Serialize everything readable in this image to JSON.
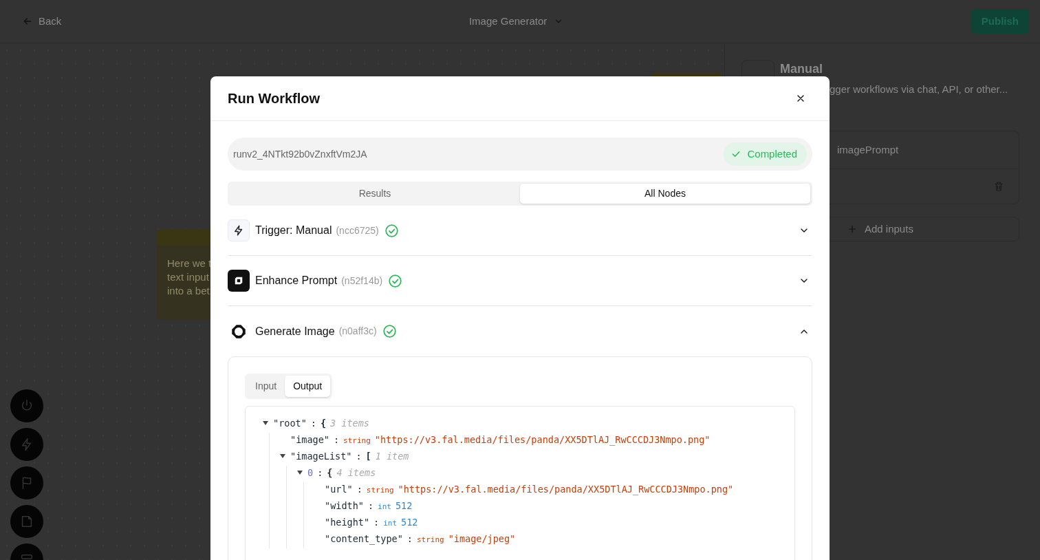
{
  "topbar": {
    "back": "Back",
    "workflow_name": "Image Generator",
    "publish": "Publish"
  },
  "canvas": {
    "note_lines": [
      "Here we t",
      "text input",
      "into a bet"
    ]
  },
  "side_panel": {
    "title": "Manual",
    "description": "gger workflows via chat, API, or other...",
    "input_name": "imagePrompt",
    "add_inputs": "Add inputs"
  },
  "modal": {
    "title": "Run Workflow",
    "run_id": "runv2_4NTkt92b0vZnxftVm2JA",
    "status": "Completed",
    "tabs": [
      {
        "label": "Results",
        "selected": false
      },
      {
        "label": "All Nodes",
        "selected": true
      }
    ],
    "nodes": [
      {
        "name": "Trigger: Manual",
        "node_id": "(ncc6725)",
        "done": true,
        "expanded": false
      },
      {
        "name": "Enhance Prompt",
        "node_id": "(n52f14b)",
        "done": true,
        "expanded": false
      },
      {
        "name": "Generate Image",
        "node_id": "(n0aff3c)",
        "done": true,
        "expanded": true
      }
    ],
    "detail_tabs": [
      {
        "label": "Input",
        "selected": false
      },
      {
        "label": "Output",
        "selected": true
      }
    ],
    "json_view": {
      "separator": ":",
      "tree": {
        "key": "\"root\"",
        "bracket": "{",
        "summary": "3 items",
        "expanded": true,
        "children": [
          {
            "key": "\"image\"",
            "type": "string",
            "kind": "string",
            "value": "\"https://v3.fal.media/files/panda/XX5DTlAJ_RwCCCDJ3Nmpo.png\""
          },
          {
            "key": "\"imageList\"",
            "bracket": "[",
            "summary": "1 item",
            "expanded": true,
            "children": [
              {
                "key": "0",
                "bracket": "{",
                "summary": "4 items",
                "expanded": true,
                "children": [
                  {
                    "key": "\"url\"",
                    "type": "string",
                    "kind": "string",
                    "value": "\"https://v3.fal.media/files/panda/XX5DTlAJ_RwCCCDJ3Nmpo.png\""
                  },
                  {
                    "key": "\"width\"",
                    "type": "int",
                    "kind": "int",
                    "value": "512"
                  },
                  {
                    "key": "\"height\"",
                    "type": "int",
                    "kind": "int",
                    "value": "512"
                  },
                  {
                    "key": "\"content_type\"",
                    "type": "string",
                    "kind": "string",
                    "value": "\"image/jpeg\""
                  }
                ]
              }
            ]
          }
        ]
      }
    }
  }
}
